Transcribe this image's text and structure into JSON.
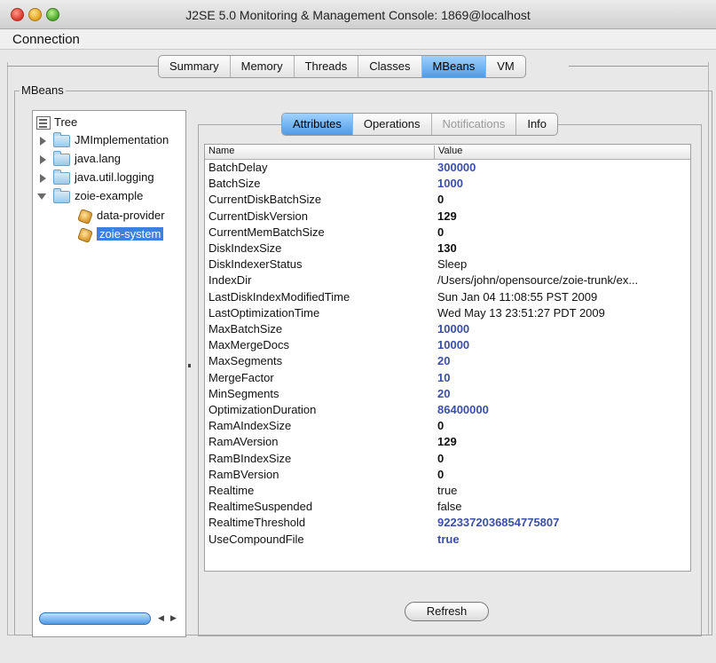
{
  "window": {
    "title": "J2SE 5.0 Monitoring & Management Console: 1869@localhost"
  },
  "menubar": {
    "connection": "Connection"
  },
  "main_tabs": [
    "Summary",
    "Memory",
    "Threads",
    "Classes",
    "MBeans",
    "VM"
  ],
  "main_tabs_selected": "MBeans",
  "mbeans": {
    "label": "MBeans",
    "tree": {
      "root": "Tree",
      "nodes": {
        "jmimpl": "JMImplementation",
        "lang": "java.lang",
        "logging": "java.util.logging",
        "zoie": "zoie-example",
        "provider": "data-provider",
        "system": "zoie-system"
      },
      "selected": "zoie-system"
    },
    "sub_tabs": [
      "Attributes",
      "Operations",
      "Notifications",
      "Info"
    ],
    "sub_tabs_selected": "Attributes",
    "sub_tabs_disabled": [
      "Notifications"
    ],
    "table": {
      "header_name": "Name",
      "header_value": "Value",
      "rows": [
        {
          "name": "BatchDelay",
          "value": "300000",
          "editable": true
        },
        {
          "name": "BatchSize",
          "value": "1000",
          "editable": true
        },
        {
          "name": "CurrentDiskBatchSize",
          "value": "0",
          "editable": false
        },
        {
          "name": "CurrentDiskVersion",
          "value": "129",
          "editable": false
        },
        {
          "name": "CurrentMemBatchSize",
          "value": "0",
          "editable": false
        },
        {
          "name": "DiskIndexSize",
          "value": "130",
          "editable": false
        },
        {
          "name": "DiskIndexerStatus",
          "value": "Sleep",
          "editable": false
        },
        {
          "name": "IndexDir",
          "value": "/Users/john/opensource/zoie-trunk/ex...",
          "editable": false
        },
        {
          "name": "LastDiskIndexModifiedTime",
          "value": "Sun Jan 04 11:08:55 PST 2009",
          "editable": false
        },
        {
          "name": "LastOptimizationTime",
          "value": "Wed May 13 23:51:27 PDT 2009",
          "editable": false
        },
        {
          "name": "MaxBatchSize",
          "value": "10000",
          "editable": true
        },
        {
          "name": "MaxMergeDocs",
          "value": "10000",
          "editable": true
        },
        {
          "name": "MaxSegments",
          "value": "20",
          "editable": true
        },
        {
          "name": "MergeFactor",
          "value": "10",
          "editable": true
        },
        {
          "name": "MinSegments",
          "value": "20",
          "editable": true
        },
        {
          "name": "OptimizationDuration",
          "value": "86400000",
          "editable": true
        },
        {
          "name": "RamAIndexSize",
          "value": "0",
          "editable": false
        },
        {
          "name": "RamAVersion",
          "value": "129",
          "editable": false
        },
        {
          "name": "RamBIndexSize",
          "value": "0",
          "editable": false
        },
        {
          "name": "RamBVersion",
          "value": "0",
          "editable": false
        },
        {
          "name": "Realtime",
          "value": "true",
          "editable": false
        },
        {
          "name": "RealtimeSuspended",
          "value": "false",
          "editable": false
        },
        {
          "name": "RealtimeThreshold",
          "value": "9223372036854775807",
          "editable": true
        },
        {
          "name": "UseCompoundFile",
          "value": "true",
          "editable": true
        }
      ]
    },
    "refresh_label": "Refresh"
  },
  "colors": {
    "selection": "#3d80df",
    "editable_value": "#3b4fa6",
    "tab_selected": "#4f9be6"
  }
}
